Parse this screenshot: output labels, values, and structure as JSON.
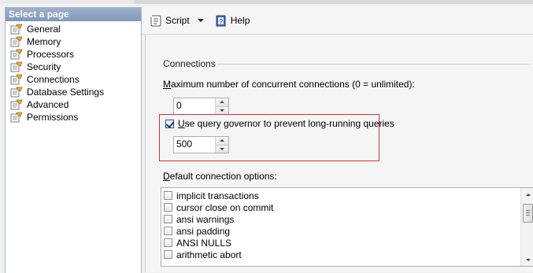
{
  "sidebar": {
    "header": "Select a page",
    "items": [
      {
        "label": "General"
      },
      {
        "label": "Memory"
      },
      {
        "label": "Processors"
      },
      {
        "label": "Security"
      },
      {
        "label": "Connections"
      },
      {
        "label": "Database Settings"
      },
      {
        "label": "Advanced"
      },
      {
        "label": "Permissions"
      }
    ]
  },
  "toolbar": {
    "script_label": "Script",
    "help_label": "Help"
  },
  "connections": {
    "section_title": "Connections",
    "max_connections_label_key": "M",
    "max_connections_label_rest": "aximum number of concurrent connections (0 = unlimited):",
    "max_connections_value": "0",
    "governor_label_key": "U",
    "governor_label_rest": "se query governor to prevent long-running queries",
    "governor_checked": true,
    "governor_value": "500",
    "default_options_label_key": "D",
    "default_options_label_rest": "efault connection options:",
    "options": [
      {
        "label": "implicit transactions",
        "checked": false
      },
      {
        "label": "cursor close on commit",
        "checked": false
      },
      {
        "label": "ansi warnings",
        "checked": false
      },
      {
        "label": "ansi padding",
        "checked": false
      },
      {
        "label": "ANSI NULLS",
        "checked": false
      },
      {
        "label": "arithmetic abort",
        "checked": false
      }
    ]
  },
  "colors": {
    "highlight_border": "#d2333d",
    "sidebar_header_bg": "#8fa5c3"
  },
  "icons": {
    "sidebar_item": "page-wrench-icon",
    "script": "script-icon",
    "help": "help-book-icon"
  }
}
